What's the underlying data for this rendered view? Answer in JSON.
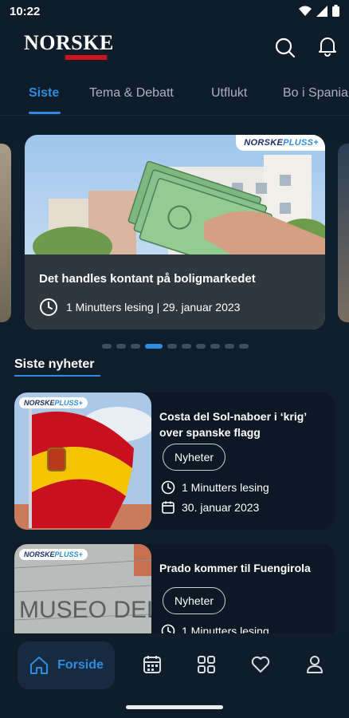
{
  "status_bar": {
    "time": "10:22"
  },
  "header": {
    "logo_text": "NORSKE",
    "search_icon": "search-icon",
    "notification_icon": "bell-icon"
  },
  "tabs": [
    {
      "label": "Siste",
      "active": true
    },
    {
      "label": "Tema & Debatt",
      "active": false
    },
    {
      "label": "Utflukt",
      "active": false
    },
    {
      "label": "Bo i Spania",
      "active": false
    }
  ],
  "featured": {
    "badge_norske": "NORSKE",
    "badge_pluss": "PLUSS+",
    "title": "Det handles kontant på boligmarkedet",
    "meta": "1  Minutters lesing | 29. januar 2023",
    "carousel_total": 10,
    "carousel_active_index": 3
  },
  "section": {
    "title": "Siste nyheter"
  },
  "news": [
    {
      "badge_norske": "NORSKE",
      "badge_pluss": "PLUSS+",
      "title": "Costa del Sol-naboer i ‘krig’ over spanske flagg",
      "category": "Nyheter",
      "read_time": "1 Minutters lesing",
      "date": "30. januar 2023"
    },
    {
      "badge_norske": "NORSKE",
      "badge_pluss": "PLUSS+",
      "title": "Prado kommer til Fuengirola",
      "category": "Nyheter",
      "read_time": "1 Minutters lesing",
      "image_text": "MUSEO DEL PR"
    }
  ],
  "bottom_nav": {
    "active_label": "Forside",
    "items": [
      "home-icon",
      "calendar-icon",
      "grid-icon",
      "heart-icon",
      "user-icon"
    ]
  },
  "colors": {
    "accent": "#2f8ce0",
    "background": "#101d2b",
    "brand_red": "#d4101c"
  }
}
